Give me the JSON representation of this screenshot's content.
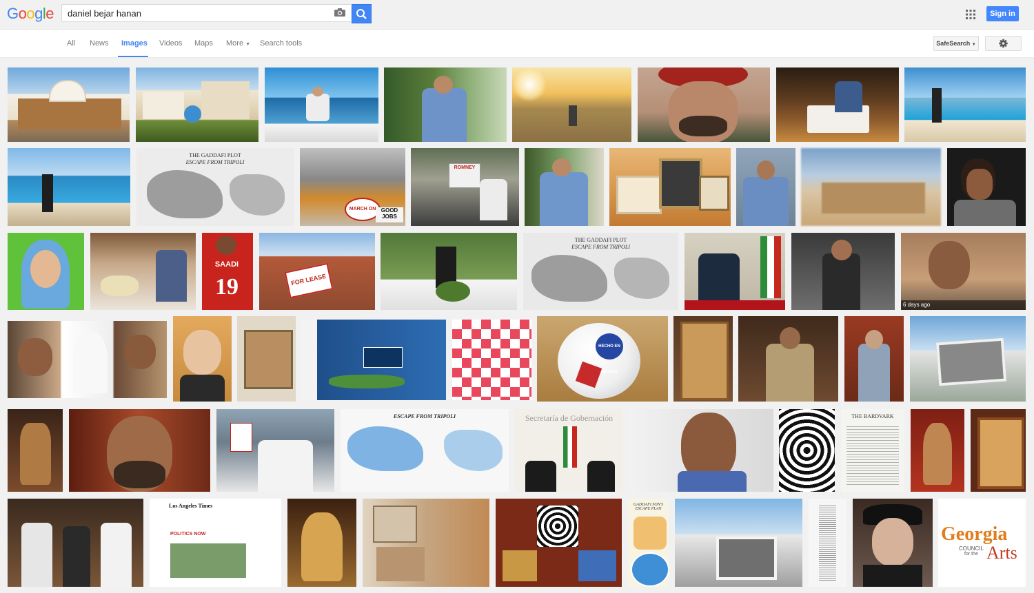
{
  "header": {
    "logo_letters": [
      "G",
      "o",
      "o",
      "g",
      "l",
      "e"
    ],
    "logo_colors": [
      "#4285f4",
      "#ea4335",
      "#fbbc05",
      "#4285f4",
      "#34a853",
      "#ea4335"
    ],
    "search_value": "daniel bejar hanan",
    "signin_label": "Sign in",
    "apps_icon": "apps-grid-icon",
    "camera_icon": "camera-icon",
    "search_icon": "magnifier-icon"
  },
  "nav": {
    "tabs": [
      "All",
      "News",
      "Images",
      "Videos",
      "Maps",
      "More",
      "Search tools"
    ],
    "active_tab": "Images",
    "safesearch_label": "SafeSearch",
    "settings_icon": "gear-icon"
  },
  "results": {
    "badge_text": "6 days ago",
    "gaddafi_plot_title": "THE GADDAFI PLOT",
    "gaddafi_plot_subtitle": "ESCAPE FROM TRIPOLI",
    "escape_title": "ESCAPE FROM TRIPOLI",
    "secretaria_caption": "Secretaría de Gobernación",
    "bardvark_caption": "THE BARDVARK",
    "latimes_caption": "Los Angeles Times",
    "politics_now": "POLITICS NOW",
    "escape_plan_caption": "GADDAFI SON'S ESCAPE PLAN",
    "saadi_caption": "SAADI",
    "saadi_number": "19",
    "romney_caption": "ROMNEY",
    "good_jobs_caption": "GOOD JOBS",
    "march_caption": "MARCH ON RNC",
    "lease_caption": "FOR LEASE",
    "mexico_caption": "HECHO EN MEXICO",
    "georgia_line1": "Georgia",
    "georgia_line2": "COUNCIL",
    "georgia_line3": "for the",
    "georgia_line4": "Arts",
    "colors": {
      "thumb_bg": "#f1f1f1",
      "accent": "#4285f4"
    }
  }
}
